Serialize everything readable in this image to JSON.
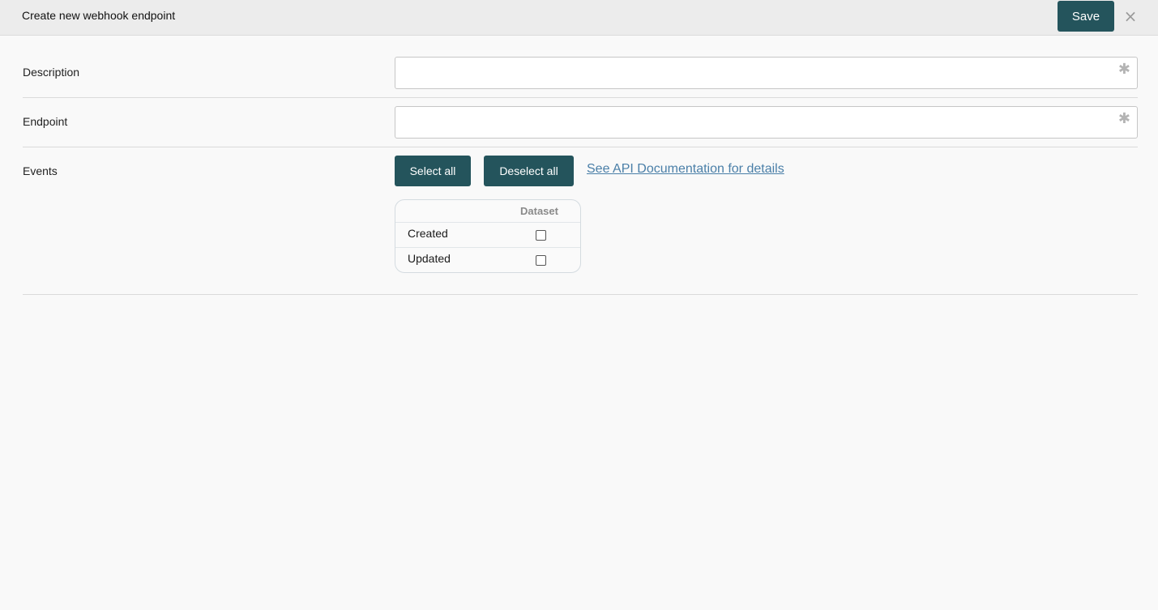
{
  "header": {
    "title": "Create new webhook endpoint",
    "save_label": "Save",
    "close_glyph": "×"
  },
  "form": {
    "description": {
      "label": "Description",
      "value": "",
      "required_glyph": "✱"
    },
    "endpoint": {
      "label": "Endpoint",
      "value": "",
      "required_glyph": "✱"
    },
    "events": {
      "label": "Events",
      "select_all_label": "Select all",
      "deselect_all_label": "Deselect all",
      "doc_link_text": "See API Documentation for details",
      "table": {
        "column_header": "Dataset",
        "rows": [
          {
            "label": "Created",
            "checked": false
          },
          {
            "label": "Updated",
            "checked": false
          }
        ]
      }
    }
  },
  "colors": {
    "primary_button": "#24545c",
    "link": "#4a7fa8",
    "header_bg": "#ececec",
    "page_bg": "#f9f9f9"
  }
}
